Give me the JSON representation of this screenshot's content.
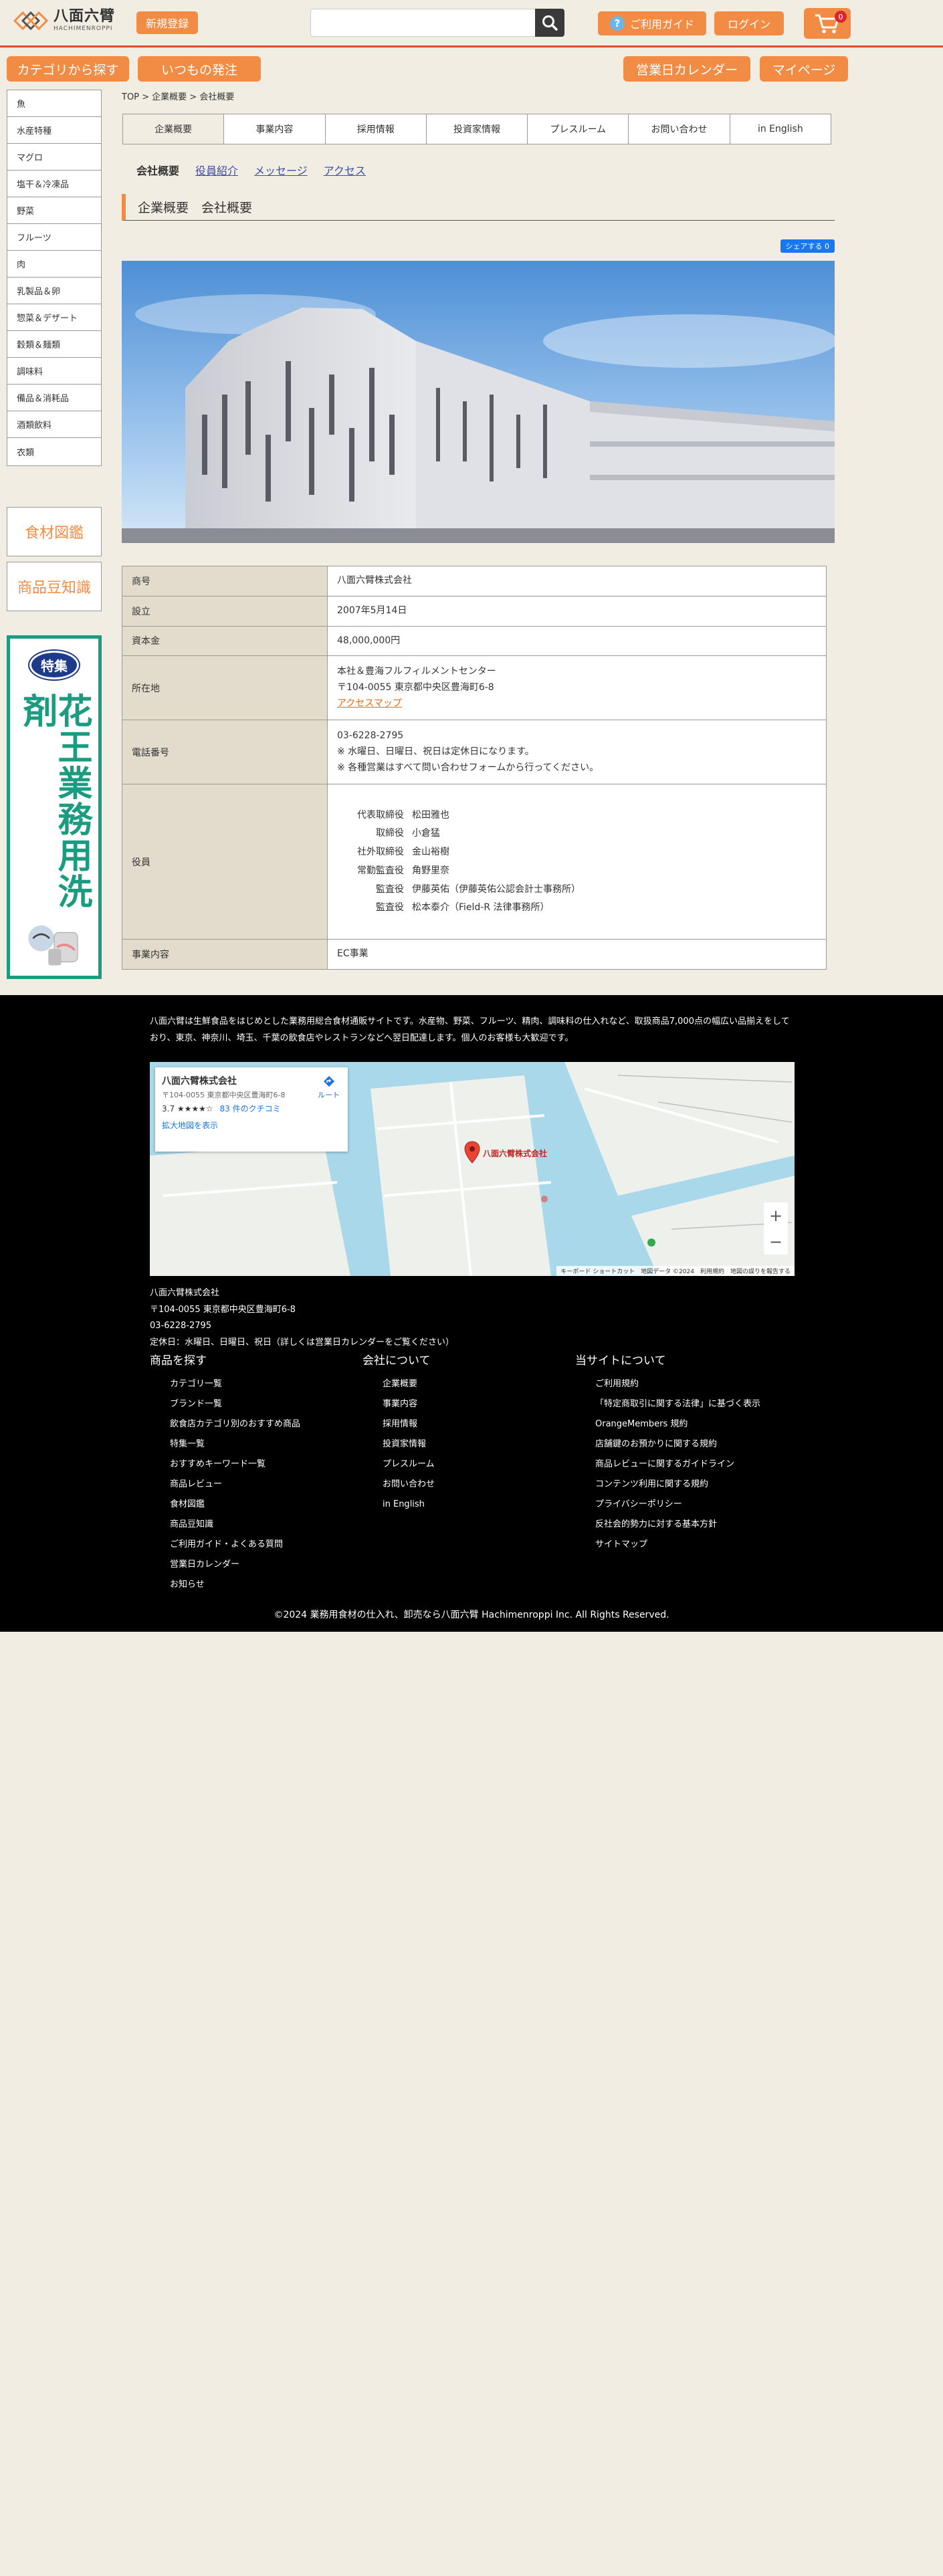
{
  "header": {
    "logo_jp": "八面六臂",
    "logo_en": "HACHIMENROPPI",
    "signup": "新規登録",
    "search_placeholder": "",
    "guide": "ご利用ガイド",
    "login": "ログイン",
    "cart_count": "0"
  },
  "subnav": {
    "category": "カテゴリから探す",
    "reorder": "いつもの発注",
    "calendar": "営業日カレンダー",
    "mypage": "マイページ"
  },
  "sidebar": {
    "categories": [
      "魚",
      "水産特種",
      "マグロ",
      "塩干＆冷凍品",
      "野菜",
      "フルーツ",
      "肉",
      "乳製品＆卵",
      "惣菜＆デザート",
      "穀類＆麺類",
      "調味料",
      "備品＆消耗品",
      "酒類飲料",
      "衣類"
    ],
    "food_dict": "食材図鑑",
    "trivia": "商品豆知識",
    "banner_tag": "特集",
    "banner_title": "花王業務用洗剤"
  },
  "breadcrumb": "TOP > 企業概要 > 会社概要",
  "tabs": [
    "企業概要",
    "事業内容",
    "採用情報",
    "投資家情報",
    "プレスルーム",
    "お問い合わせ",
    "in English"
  ],
  "subtabs": [
    "会社概要",
    "役員紹介",
    "メッセージ",
    "アクセス"
  ],
  "section_title": "企業概要　会社概要",
  "share_label": "シェアする 0",
  "company_table": [
    {
      "label": "商号",
      "lines": [
        "八面六臂株式会社"
      ]
    },
    {
      "label": "設立",
      "lines": [
        "2007年5月14日"
      ]
    },
    {
      "label": "資本金",
      "lines": [
        "48,000,000円"
      ]
    },
    {
      "label": "所在地",
      "lines": [
        "本社＆豊海フルフィルメントセンター",
        "〒104-0055 東京都中央区豊海町6-8"
      ],
      "link": "アクセスマップ"
    },
    {
      "label": "電話番号",
      "lines": [
        "03-6228-2795",
        "※ 水曜日、日曜日、祝日は定休日になります。",
        "※ 各種営業はすべて問い合わせフォームから行ってください。"
      ]
    },
    {
      "label": "役員",
      "officers": [
        {
          "role": "代表取締役",
          "name": "松田雅也"
        },
        {
          "role": "取締役",
          "name": "小倉猛"
        },
        {
          "role": "社外取締役",
          "name": "金山裕樹"
        },
        {
          "role": "常勤監査役",
          "name": "角野里奈"
        },
        {
          "role": "監査役",
          "name": "伊藤英佑（伊藤英佑公認会計士事務所）"
        },
        {
          "role": "監査役",
          "name": "松本泰介（Field-R 法律事務所）"
        }
      ]
    },
    {
      "label": "事業内容",
      "lines": [
        "EC事業"
      ]
    }
  ],
  "footer": {
    "intro": "八面六臂は生鮮食品をはじめとした業務用総合食材通販サイトです。水産物、野菜、フルーツ、精肉、調味料の仕入れなど、取扱商品7,000点の幅広い品揃えをしており、東京、神奈川、埼玉、千葉の飲食店やレストランなどへ翌日配達します。個人のお客様も大歓迎です。",
    "map": {
      "name": "八面六臂株式会社",
      "address": "〒104-0055 東京都中央区豊海町6-8",
      "rating": "3.7 ★★★★☆",
      "reviews": "83 件のクチコミ",
      "route": "ルート",
      "larger": "拡大地図を表示",
      "pin_label": "八面六臂株式会社",
      "attrib": "キーボード ショートカット　地図データ ©2024　利用規約　地図の誤りを報告する"
    },
    "company": [
      "八面六臂株式会社",
      "〒104-0055 東京都中央区豊海町6-8",
      "03-6228-2795",
      "定休日：水曜日、日曜日、祝日（詳しくは営業日カレンダーをご覧ください）"
    ],
    "columns": [
      {
        "title": "商品を探す",
        "items": [
          "カテゴリ一覧",
          "ブランド一覧",
          "飲食店カテゴリ別のおすすめ商品",
          "特集一覧",
          "おすすめキーワード一覧",
          "商品レビュー",
          "食材図鑑",
          "商品豆知識",
          "ご利用ガイド・よくある質問",
          "営業日カレンダー",
          "お知らせ"
        ]
      },
      {
        "title": "会社について",
        "items": [
          "企業概要",
          "事業内容",
          "採用情報",
          "投資家情報",
          "プレスルーム",
          "お問い合わせ",
          "in English"
        ]
      },
      {
        "title": "当サイトについて",
        "items": [
          "ご利用規約",
          "「特定商取引に関する法律」に基づく表示",
          "OrangeMembers 規約",
          "店舗鍵のお預かりに関する規約",
          "商品レビューに関するガイドライン",
          "コンテンツ利用に関する規約",
          "プライバシーポリシー",
          "反社会的勢力に対する基本方針",
          "サイトマップ"
        ]
      }
    ],
    "copyright": "©2024 業務用食材の仕入れ、卸売なら八面六臂 Hachimenroppi Inc. All Rights Reserved."
  },
  "colors": {
    "accent": "#f28c45",
    "header_rule": "#d8502a",
    "page_bg": "#f2ede3",
    "banner_green": "#1b9b7f"
  }
}
